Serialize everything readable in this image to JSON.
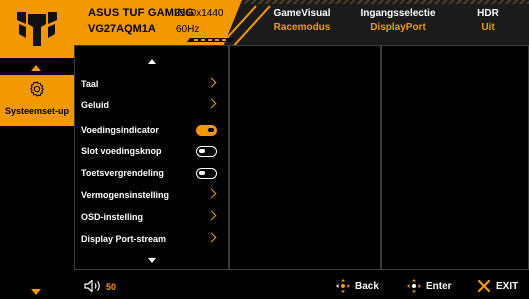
{
  "header": {
    "model_name": "ASUS TUF GAMING",
    "model_number": "VG27AQM1A",
    "resolution": "2560x1440",
    "refresh_rate": "60Hz",
    "columns": [
      {
        "title": "GameVisual",
        "value": "Racemodus"
      },
      {
        "title": "Ingangsselectie",
        "value": "DisplayPort"
      },
      {
        "title": "HDR",
        "value": "Uit"
      }
    ]
  },
  "sidebar": {
    "active_label": "Systeemset-up",
    "active_icon": "gear-icon"
  },
  "menu": {
    "items": [
      {
        "label": "Taal",
        "control": "chevron"
      },
      {
        "label": "Geluid",
        "control": "chevron"
      },
      {
        "label": "Voedingsindicator",
        "control": "toggle",
        "state": "on"
      },
      {
        "label": "Slot voedingsknop",
        "control": "toggle",
        "state": "off"
      },
      {
        "label": "Toetsvergrendeling",
        "control": "toggle",
        "state": "off"
      },
      {
        "label": "Vermogensinstelling",
        "control": "chevron"
      },
      {
        "label": "OSD-instelling",
        "control": "chevron"
      },
      {
        "label": "Display Port-stream",
        "control": "chevron"
      }
    ]
  },
  "footer": {
    "volume_icon": "speaker-icon",
    "volume": "50",
    "back_label": "Back",
    "enter_label": "Enter",
    "exit_label": "EXIT"
  },
  "colors": {
    "accent": "#f39800",
    "background": "#000000",
    "header_bg": "#1b1b1b",
    "panel_border": "#3c3c3c"
  }
}
